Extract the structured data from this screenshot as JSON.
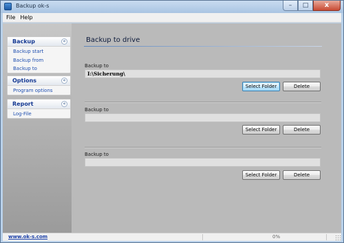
{
  "window": {
    "title": "Backup ok-s"
  },
  "title_buttons": {
    "minimize": "–",
    "maximize": "□",
    "close": "x"
  },
  "menu": [
    "File",
    "Help"
  ],
  "sidebar": {
    "panels": [
      {
        "title": "Backup",
        "toggle": "«",
        "links": [
          "Backup start",
          "Backup from",
          "Backup to"
        ]
      },
      {
        "title": "Options",
        "toggle": "«",
        "links": [
          "Program options"
        ]
      },
      {
        "title": "Report",
        "toggle": "«",
        "links": [
          "Log-File"
        ]
      }
    ]
  },
  "main": {
    "title": "Backup to drive",
    "groups": [
      {
        "label": "Backup to",
        "path": "I:\\Sicherung\\",
        "select_label": "Select Folder",
        "delete_label": "Delete"
      },
      {
        "label": "Backup to",
        "path": "",
        "select_label": "Select Folder",
        "delete_label": "Delete"
      },
      {
        "label": "Backup to",
        "path": "",
        "select_label": "Select Folder",
        "delete_label": "Delete"
      }
    ]
  },
  "status": {
    "link": "www.ok-s.com",
    "progress": "0%"
  },
  "icons": {
    "app": "backup-app-icon",
    "panel_toggle": "collapse-chevron-icon",
    "grip": "resize-grip-icon"
  }
}
